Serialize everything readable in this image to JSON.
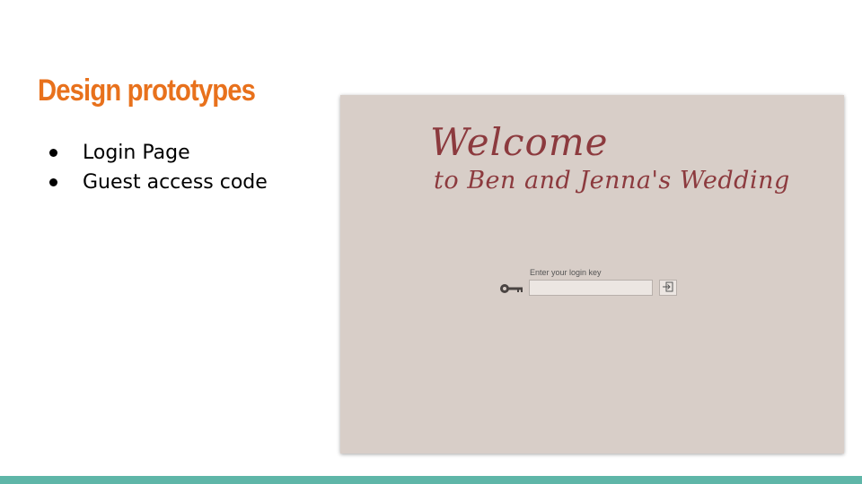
{
  "slide": {
    "title": "Design prototypes",
    "bullets": [
      "Login Page",
      "Guest access code"
    ]
  },
  "prototype": {
    "welcome_title": "Welcome",
    "welcome_subtitle": "to Ben and Jenna's Wedding",
    "login_label": "Enter your login key",
    "login_value": "",
    "icons": {
      "key": "key-icon",
      "submit": "login-arrow-icon"
    }
  },
  "colors": {
    "title": "#e8711c",
    "script_text": "#8c3a3e",
    "prototype_bg": "#d8cec8",
    "bottom_bar": "#5fb6a8"
  }
}
